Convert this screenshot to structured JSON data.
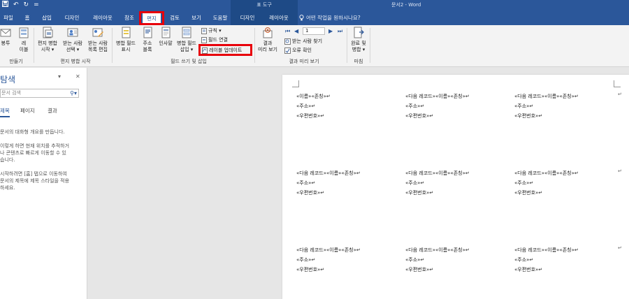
{
  "qat": {
    "save_icon": "save-icon",
    "undo_glyph": "↶",
    "redo_glyph": "↻",
    "more_glyph": "="
  },
  "title": {
    "context_group": "표 도구",
    "doc_title": "문서2 - Word"
  },
  "tabs": [
    "파일",
    "홈",
    "삽입",
    "디자인",
    "레이아웃",
    "참조",
    "편지",
    "검토",
    "보기",
    "도움말",
    "디자인",
    "레이아웃"
  ],
  "active_tab_index": 6,
  "tellme": "어떤 작업을 원하시나요?",
  "ribbon": {
    "create": {
      "envelope": "봉투",
      "labels_l1": "레",
      "labels_l2": "이블",
      "group": "만들기"
    },
    "start_merge": {
      "start_l1": "편지 병합",
      "start_l2": "시작 ▾",
      "select_l1": "받는 사람",
      "select_l2": "선택 ▾",
      "edit_l1": "받는 사람",
      "edit_l2": "목록 편집",
      "group": "편지 병합 시작"
    },
    "fields": {
      "highlight_l1": "병합 필드",
      "highlight_l2": "표시",
      "address_l1": "주소",
      "address_l2": "블록",
      "greeting_l1": "인사말",
      "greeting_l2": "",
      "insert_l1": "병합 필드",
      "insert_l2": "삽입 ▾",
      "rules": "규칙 ▾",
      "match": "필드 연결",
      "update": "레이블 업데이트",
      "group": "필드 쓰기 및 삽입"
    },
    "preview": {
      "results_l1": "결과",
      "results_l2": "미리 보기",
      "record": "1",
      "find": "받는 사람 찾기",
      "check": "오류 확인",
      "group": "결과 미리 보기"
    },
    "finish": {
      "btn_l1": "완료 및",
      "btn_l2": "병합 ▾",
      "group": "마침"
    }
  },
  "nav": {
    "title": "탐색",
    "search_placeholder": "문서 검색",
    "tabs": [
      "제목",
      "페이지",
      "결과"
    ],
    "para1": "문서의 대화형 개요를 만듭니다.",
    "para2_l1": "이렇게 하면 현재 위치를 추적하거",
    "para2_l2": "나 콘텐츠로 빠르게 이동할 수 있",
    "para2_l3": "습니다.",
    "para3_l1": "시작하려면 [홈] 탭으로 이동하여",
    "para3_l2": "문서의 제목에 제목 스타일을 적용",
    "para3_l3": "하세요."
  },
  "labels": {
    "first_name_line": "«이름»«존칭»↵",
    "next_name_line": "«다음 레코드»«이름»«존칭»↵",
    "address_line": "«주소»↵",
    "postal_line": "«우편번호»↵",
    "pilcrow": "↵"
  }
}
